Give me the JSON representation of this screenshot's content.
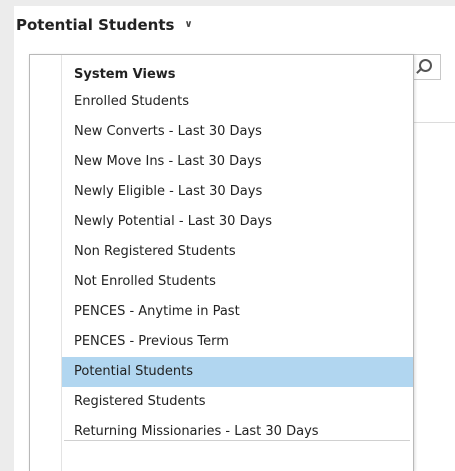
{
  "header": {
    "current_view": "Potential Students",
    "chevron_icon": "chevron-down-icon"
  },
  "search": {
    "icon": "search-icon"
  },
  "dropdown": {
    "group_label": "System Views",
    "items": [
      {
        "label": "Enrolled Students"
      },
      {
        "label": "New Converts - Last 30 Days"
      },
      {
        "label": "New Move Ins - Last 30 Days"
      },
      {
        "label": "Newly Eligible - Last 30 Days"
      },
      {
        "label": "Newly Potential - Last 30 Days"
      },
      {
        "label": "Non Registered Students"
      },
      {
        "label": "Not Enrolled Students"
      },
      {
        "label": "PENCES - Anytime in Past"
      },
      {
        "label": "PENCES - Previous Term"
      },
      {
        "label": "Potential Students",
        "selected": true
      },
      {
        "label": "Registered Students"
      },
      {
        "label": "Returning Missionaries - Last 30 Days"
      }
    ],
    "selected_color": "#b1d6f0"
  }
}
